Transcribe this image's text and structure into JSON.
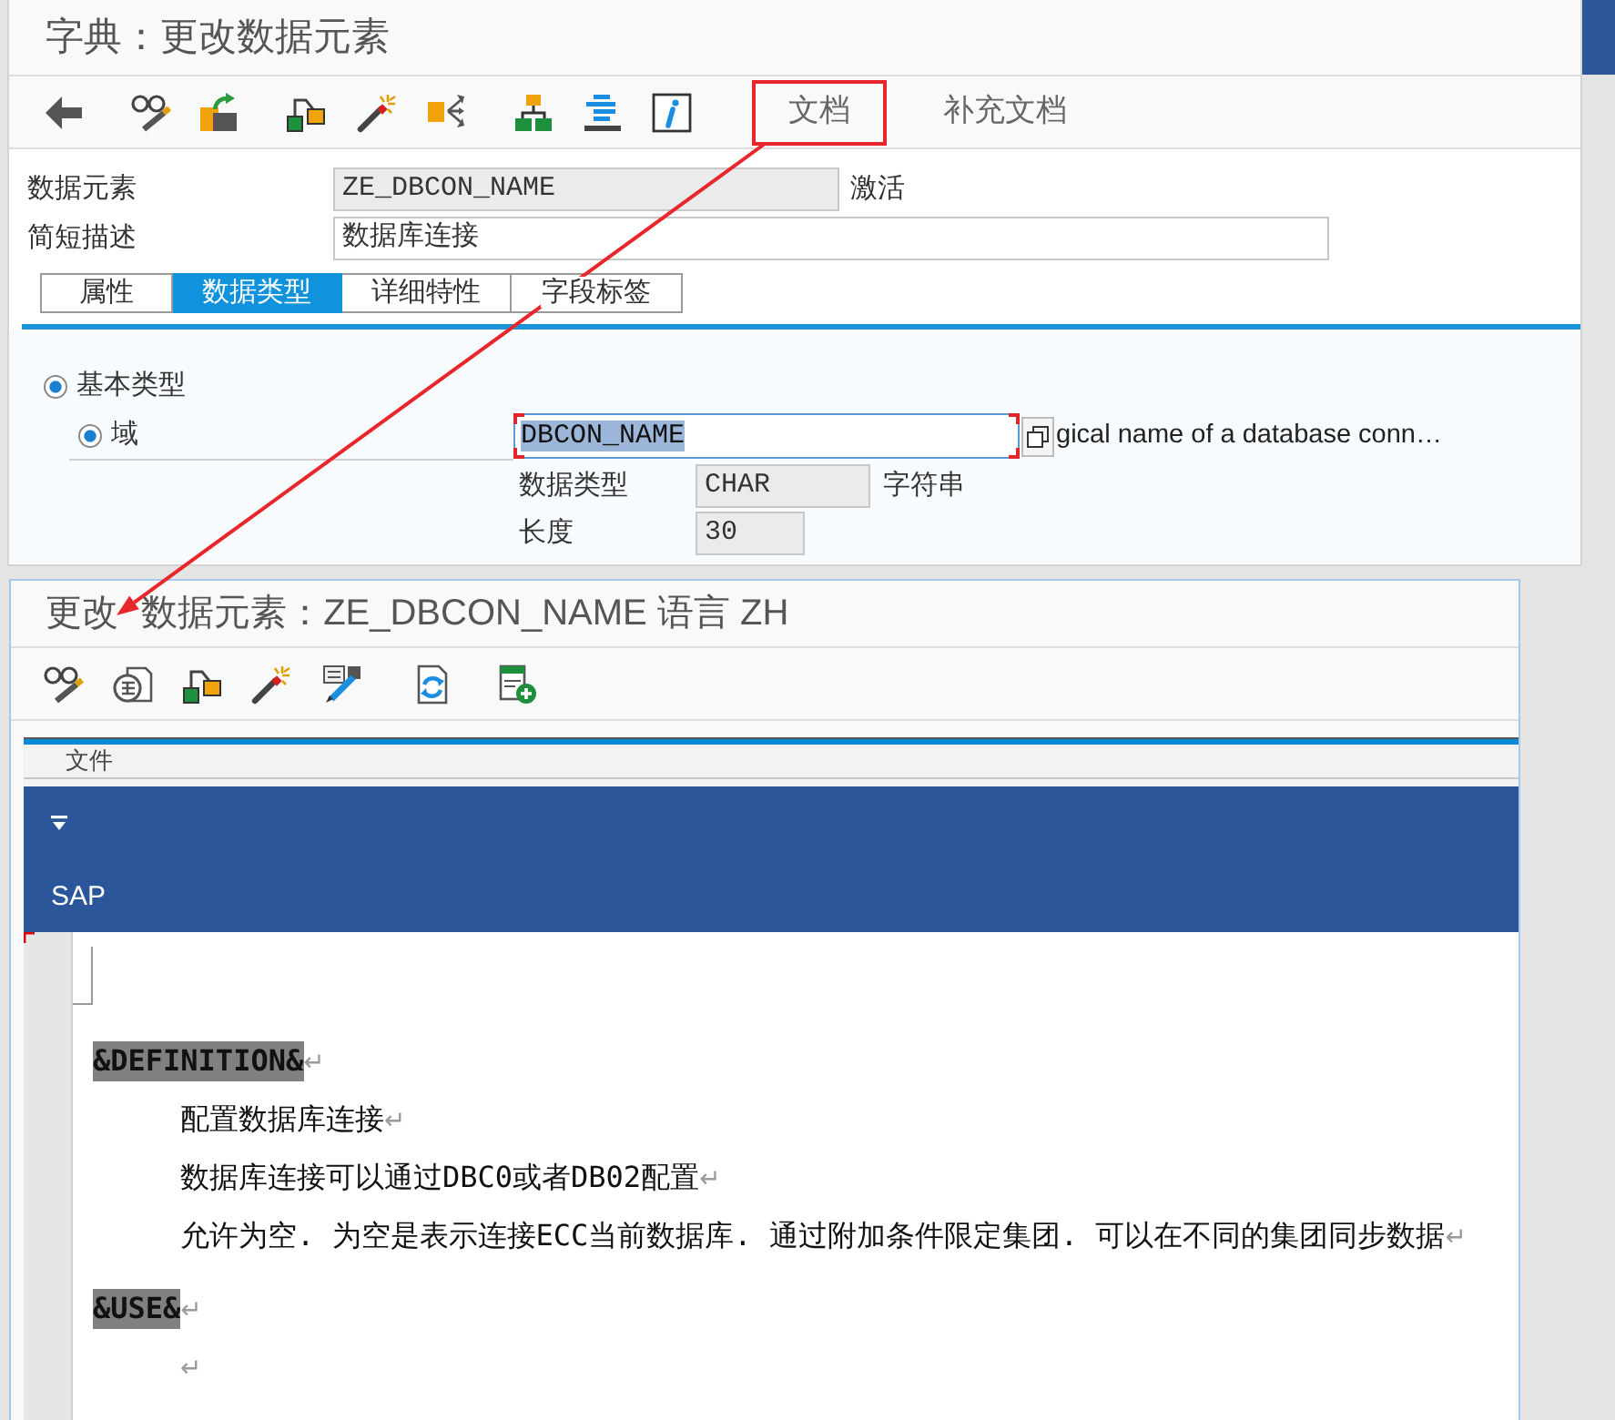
{
  "window": {
    "title": "字典：更改数据元素"
  },
  "toolbar": {
    "text_buttons": [
      {
        "label": "文档",
        "annotated": true
      },
      {
        "label": "补充文档",
        "annotated": false
      }
    ]
  },
  "header_fields": [
    {
      "label": "数据元素",
      "value": "ZE_DBCON_NAME",
      "editable": false,
      "status": "激活"
    },
    {
      "label": "简短描述",
      "value": "数据库连接",
      "editable": true
    }
  ],
  "tabs": [
    {
      "label": "属性",
      "selected": false
    },
    {
      "label": "数据类型",
      "selected": true
    },
    {
      "label": "详细特性",
      "selected": false
    },
    {
      "label": "字段标签",
      "selected": false
    }
  ],
  "type_options": [
    {
      "label": "基本类型",
      "checked": true,
      "children": [
        {
          "label": "域",
          "checked": true
        }
      ]
    }
  ],
  "domain": {
    "value": "DBCON_NAME",
    "text_selected": true,
    "focused": true,
    "description": "gical name of a database conn…"
  },
  "domain_details": [
    {
      "label": "数据类型",
      "value": "CHAR",
      "note": "字符串"
    },
    {
      "label": "长度",
      "value": "30"
    }
  ],
  "doc_window": {
    "title": "更改 数据元素：ZE_DBCON_NAME 语言 ZH",
    "menu": [
      "文件"
    ],
    "ribbon_label": "SAP",
    "paragraphs": [
      {
        "kind": "heading",
        "text": "&DEFINITION&",
        "end_mark": "↵"
      },
      {
        "kind": "body",
        "text": "配置数据库连接",
        "end_mark": "↵"
      },
      {
        "kind": "body",
        "text": "数据库连接可以通过DBC0或者DB02配置",
        "end_mark": "↵"
      },
      {
        "kind": "body",
        "text": "允许为空. 为空是表示连接ECC当前数据库. 通过附加条件限定集团. 可以在不同的集团同步数据",
        "end_mark": "↵"
      },
      {
        "kind": "heading",
        "text": "&USE&",
        "end_mark": "↵"
      },
      {
        "kind": "body",
        "end_mark": "↵"
      }
    ]
  }
}
